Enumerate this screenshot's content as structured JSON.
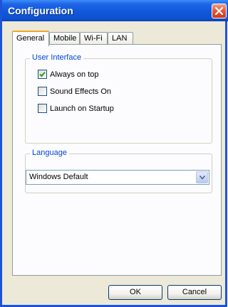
{
  "window": {
    "title": "Configuration"
  },
  "tabs": [
    {
      "label": "General",
      "active": true
    },
    {
      "label": "Mobile",
      "active": false
    },
    {
      "label": "Wi-Fi",
      "active": false
    },
    {
      "label": "LAN",
      "active": false
    }
  ],
  "user_interface": {
    "label": "User Interface",
    "options": [
      {
        "label": "Always on top",
        "checked": true
      },
      {
        "label": "Sound Effects On",
        "checked": false
      },
      {
        "label": "Launch on Startup",
        "checked": false
      }
    ]
  },
  "language": {
    "label": "Language",
    "selected": "Windows Default"
  },
  "buttons": {
    "ok": "OK",
    "cancel": "Cancel"
  },
  "colors": {
    "titlebar": "#0f52d0",
    "group_label": "#0046d5",
    "close": "#e1583b",
    "dialog_bg": "#ece9d8"
  },
  "icons": {
    "close": "close-icon",
    "check": "check-icon",
    "dropdown": "chevron-down-icon"
  }
}
